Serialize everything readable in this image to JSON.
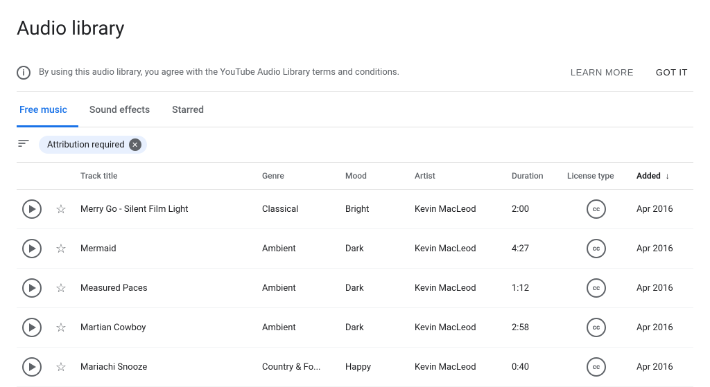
{
  "page": {
    "title": "Audio library"
  },
  "banner": {
    "text": "By using this audio library, you agree with the YouTube Audio Library terms and conditions.",
    "learn_more": "LEARN MORE",
    "got_it": "GOT IT"
  },
  "tabs": [
    {
      "id": "free-music",
      "label": "Free music",
      "active": true
    },
    {
      "id": "sound-effects",
      "label": "Sound effects",
      "active": false
    },
    {
      "id": "starred",
      "label": "Starred",
      "active": false
    }
  ],
  "filter": {
    "label": "Attribution required",
    "icon": "filter-icon"
  },
  "table": {
    "columns": [
      {
        "id": "play",
        "label": ""
      },
      {
        "id": "star",
        "label": ""
      },
      {
        "id": "title",
        "label": "Track title"
      },
      {
        "id": "genre",
        "label": "Genre"
      },
      {
        "id": "mood",
        "label": "Mood"
      },
      {
        "id": "artist",
        "label": "Artist"
      },
      {
        "id": "duration",
        "label": "Duration"
      },
      {
        "id": "license",
        "label": "License type"
      },
      {
        "id": "added",
        "label": "Added",
        "sorted": true,
        "sort_dir": "desc"
      }
    ],
    "rows": [
      {
        "title": "Merry Go - Silent Film Light",
        "genre": "Classical",
        "mood": "Bright",
        "artist": "Kevin MacLeod",
        "duration": "2:00",
        "license": "CC",
        "added": "Apr 2016"
      },
      {
        "title": "Mermaid",
        "genre": "Ambient",
        "mood": "Dark",
        "artist": "Kevin MacLeod",
        "duration": "4:27",
        "license": "CC",
        "added": "Apr 2016"
      },
      {
        "title": "Measured Paces",
        "genre": "Ambient",
        "mood": "Dark",
        "artist": "Kevin MacLeod",
        "duration": "1:12",
        "license": "CC",
        "added": "Apr 2016"
      },
      {
        "title": "Martian Cowboy",
        "genre": "Ambient",
        "mood": "Dark",
        "artist": "Kevin MacLeod",
        "duration": "2:58",
        "license": "CC",
        "added": "Apr 2016"
      },
      {
        "title": "Mariachi Snooze",
        "genre": "Country & Fo...",
        "mood": "Happy",
        "artist": "Kevin MacLeod",
        "duration": "0:40",
        "license": "CC",
        "added": "Apr 2016"
      }
    ]
  }
}
